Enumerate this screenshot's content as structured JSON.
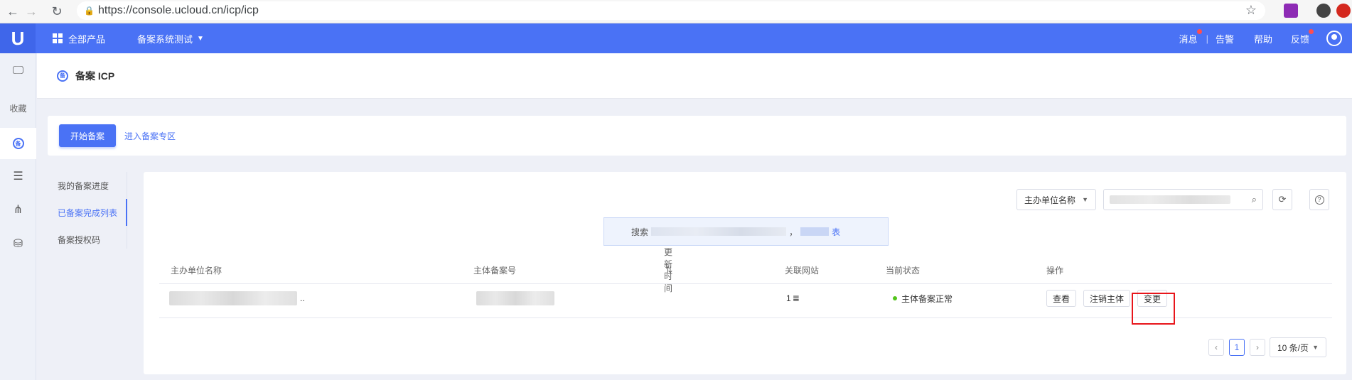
{
  "browser": {
    "url": "https://console.ucloud.cn/icp/icp"
  },
  "topnav": {
    "logo": "U",
    "all_products": "全部产品",
    "project": "备案系统测试",
    "messages": "消息",
    "alerts": "告警",
    "help": "帮助",
    "feedback": "反馈"
  },
  "sidebar": {
    "favorites_label": "收藏",
    "icp_icon_text": "备"
  },
  "page": {
    "title": "备案 ICP",
    "title_icon_text": "备"
  },
  "actions": {
    "start_filing": "开始备案",
    "enter_zone": "进入备案专区"
  },
  "subnav": {
    "items": [
      {
        "label": "我的备案进度"
      },
      {
        "label": "已备案完成列表"
      },
      {
        "label": "备案授权码"
      }
    ]
  },
  "toolbar": {
    "filter_value": "主办单位名称",
    "search_placeholder": ""
  },
  "notice": {
    "prefix": "搜索",
    "middle": "，",
    "link_suffix": "表"
  },
  "table": {
    "columns": [
      "主办单位名称",
      "主体备案号",
      "更新时间",
      "关联网站",
      "当前状态",
      "操作"
    ],
    "sort_icon": "⇅",
    "rows": [
      {
        "name_suffix": "..",
        "site_count": "1",
        "site_icon": "≣",
        "status": "主体备案正常",
        "ops": [
          "查看",
          "注销主体",
          "变更"
        ]
      }
    ]
  },
  "pagination": {
    "prev": "‹",
    "current": "1",
    "next": "›",
    "page_size": "10 条/页"
  },
  "colors": {
    "brand": "#4a72f5",
    "highlight_box": "#e8151b",
    "status_ok": "#52c41a"
  }
}
